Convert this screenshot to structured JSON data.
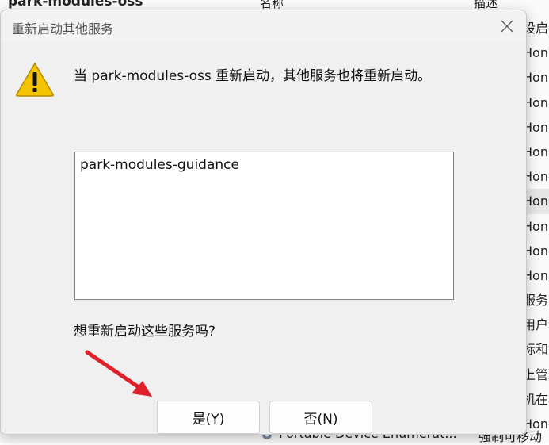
{
  "background": {
    "header": {
      "name_col": "park-modules-oss",
      "name_col2": "名称",
      "desc_col": "描述"
    },
    "right_rows": [
      "设启动",
      "Hong",
      "Hong",
      "Hong",
      "Hong",
      "Hong",
      "Hong",
      "Hong",
      "Hong",
      "Hong",
      "Hong",
      "服务",
      "用户和",
      "标和智",
      "上管理",
      "机在标",
      "Hong"
    ],
    "bottom_row": {
      "name": "Portable Device Enumerat...",
      "desc": "强制可移动"
    }
  },
  "dialog": {
    "title": "重新启动其他服务",
    "close_icon": "close-icon",
    "warning_icon": "warning-icon",
    "message": "当 park-modules-oss 重新启动，其他服务也将重新启动。",
    "services": [
      "park-modules-guidance"
    ],
    "question": "想重新启动这些服务吗?",
    "yes_label": "是(Y)",
    "no_label": "否(N)",
    "annotation": "red-arrow-pointing-at-yes"
  },
  "colors": {
    "dialog_bg": "#f0f0f0",
    "warning_yellow": "#f5c400",
    "arrow_red": "#e0202a"
  }
}
